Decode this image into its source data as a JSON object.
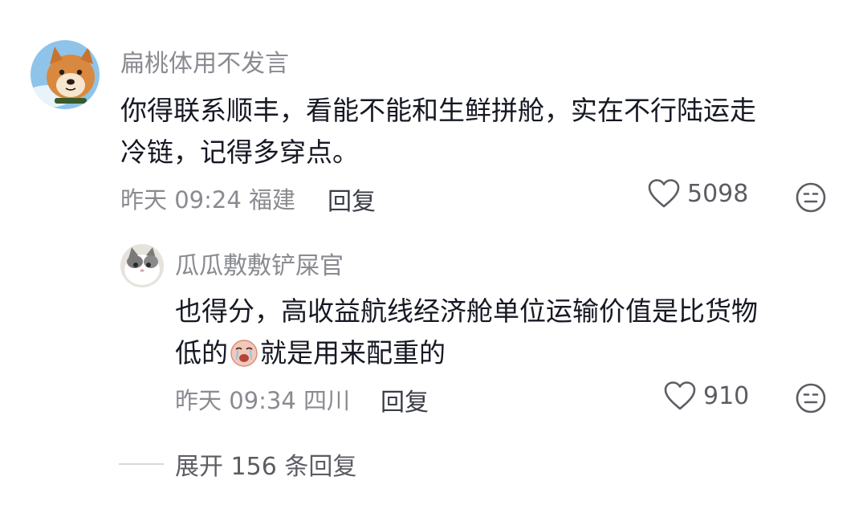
{
  "comments": [
    {
      "username": "扁桃体用不发言",
      "avatar": "shiba-dog-avatar",
      "content_lines": [
        "你得联系顺丰，看能不能和生鲜拼舱，实在不行陆运走",
        "冷链，记得多穿点。"
      ],
      "meta": "昨天 09:24 福建",
      "reply_label": "回复",
      "like_count": "5098"
    },
    {
      "username": "瓜瓜敷敷铲屎官",
      "avatar": "cat-avatar",
      "content_line1": "也得分，高收益航线经济舱单位运输价值是比货物",
      "content_line2_prefix": "低的",
      "content_emoji": "crying-face-emoji",
      "content_line2_suffix": "就是用来配重的",
      "meta": "昨天 09:34 四川",
      "reply_label": "回复",
      "like_count": "910"
    }
  ],
  "expand": {
    "label": "展开 156 条回复"
  },
  "colors": {
    "username": "#8a8b91",
    "body_text": "#161823",
    "meta": "#8a8b91",
    "reply": "#3a3c45"
  }
}
